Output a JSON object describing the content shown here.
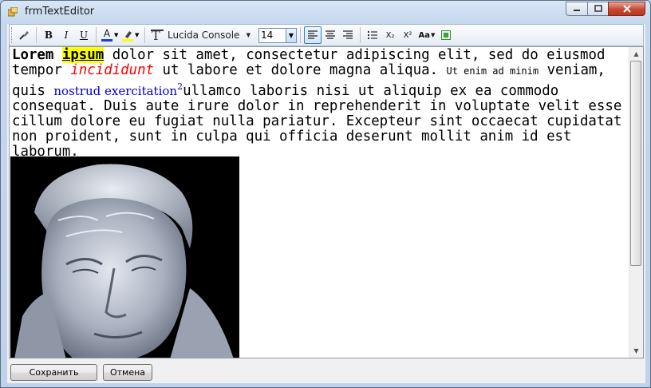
{
  "window": {
    "title": "frmTextEditor"
  },
  "toolbar": {
    "bold_label": "B",
    "italic_label": "I",
    "underline_label": "U",
    "font_color_label": "A",
    "font_name": "Lucida Console",
    "font_size": "14",
    "subscript_label": "X₂",
    "superscript_label": "X²",
    "change_case_label": "Aa",
    "colors": {
      "font_color": "#1a3ed8",
      "highlight_color": "#ffff00"
    }
  },
  "document": {
    "bold_word": "Lorem",
    "highlight_word": "ipsum",
    "text1": "dolor sit amet, consectetur adipiscing elit, sed do eiusmod tempor",
    "red_italic": "incididunt",
    "text2": "ut labore et dolore magna aliqua.",
    "small_text": "Ut enim ad minim",
    "text3": "veniam, quis",
    "blue_serif": "nostrud exercitation",
    "superscript": "2",
    "text4": "ullamco laboris nisi ut aliquip ex ea commodo consequat. Duis aute irure dolor in reprehenderit in voluptate velit esse cillum dolore eu fugiat nulla pariatur. Excepteur sint occaecat cupidatat non proident, sunt in culpa qui officia deserunt mollit anim id est laborum."
  },
  "buttons": {
    "save": "Сохранить",
    "cancel": "Отмена"
  }
}
